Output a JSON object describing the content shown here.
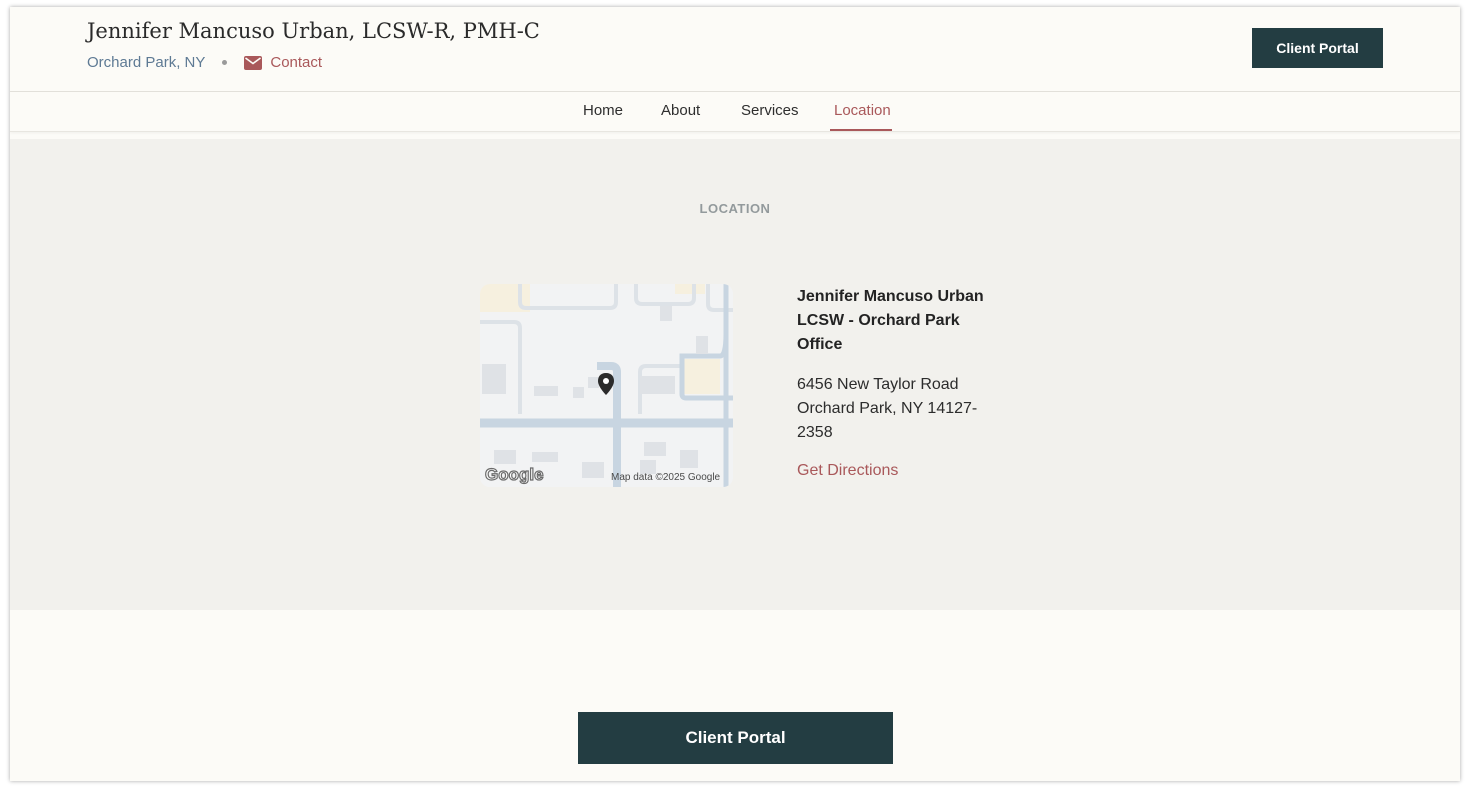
{
  "header": {
    "name": "Jennifer Mancuso Urban, LCSW-R, PMH-C",
    "location": "Orchard Park, NY",
    "contact_label": "Contact",
    "client_portal_label": "Client Portal"
  },
  "nav": {
    "items": [
      {
        "label": "Home",
        "active": false
      },
      {
        "label": "About",
        "active": false
      },
      {
        "label": "Services",
        "active": false
      },
      {
        "label": "Location",
        "active": true
      }
    ]
  },
  "location_section": {
    "eyebrow": "LOCATION",
    "office_name": "Jennifer Mancuso Urban LCSW - Orchard Park Office",
    "address_lines": [
      "6456 New Taylor Road",
      "Orchard Park, NY 14127-",
      "2358"
    ],
    "directions_label": "Get Directions",
    "map": {
      "logo_text": "Google",
      "attribution": "Map data ©2025 Google"
    }
  },
  "footer": {
    "client_portal_label": "Client Portal"
  },
  "colors": {
    "accent": "#a9585a",
    "button_bg": "#233d42",
    "page_bg": "#fcfbf7",
    "section_bg": "#f2f1ed",
    "muted_link": "#5e7a94"
  },
  "icons": {
    "contact": "mail-icon",
    "map_pin": "map-pin-icon"
  }
}
